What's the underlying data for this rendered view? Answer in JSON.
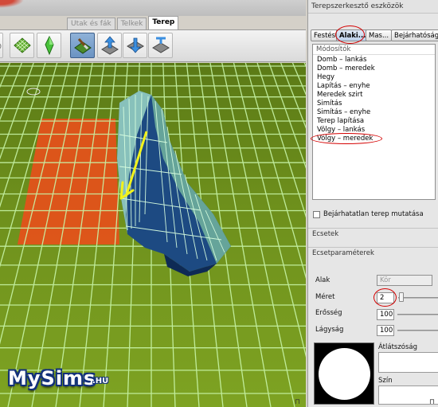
{
  "viewport": {
    "tabs": [
      {
        "label": "Utak és fák",
        "active": false
      },
      {
        "label": "Telkek",
        "active": false
      },
      {
        "label": "Terep",
        "active": true
      }
    ],
    "tool_icons": [
      "terrain-grid-icon",
      "sim-plumbob-icon",
      "terrain-paint-icon",
      "terrain-raise-icon",
      "terrain-lower-icon",
      "terrain-flatten-icon"
    ],
    "logo": {
      "text": "MySims",
      "suffix": ".HU"
    },
    "colors": {
      "grass": "#6d8f1c",
      "grid": "#c8f5a8",
      "lot": "#e6501a",
      "arrow": "#f2f21c",
      "valley": "#1a3f7a"
    }
  },
  "panel": {
    "title": "Terepszerkesztő eszközök",
    "buttons": [
      "Festés",
      "Alaki...",
      "Mas...",
      "Bejárhatóság"
    ],
    "selected_button": "Alaki...",
    "modifiers_header": "Módosítók",
    "modifiers": [
      "Domb – lankás",
      "Domb – meredek",
      "Hegy",
      "Lapítás – enyhe",
      "Meredek szirt",
      "Simítás",
      "Simítás – enyhe",
      "Terep lapítása",
      "Völgy – lankás",
      "Völgy – meredek"
    ],
    "selected_modifier": "Völgy – meredek",
    "show_unwalkable_label": "Bejárhatatlan terep mutatása",
    "show_unwalkable_checked": false,
    "brushes_label": "Ecsetek",
    "brush_params_label": "Ecsetparaméterek",
    "shape_label": "Alak",
    "shape_value": "Kör",
    "size_label": "Méret",
    "size_value": "2",
    "strength_label": "Erősség",
    "strength_value": "100",
    "softness_label": "Lágyság",
    "softness_value": "100",
    "opacity_label": "Átlátszóság",
    "color_label": "Szín",
    "highlight_color": "#d40000"
  }
}
